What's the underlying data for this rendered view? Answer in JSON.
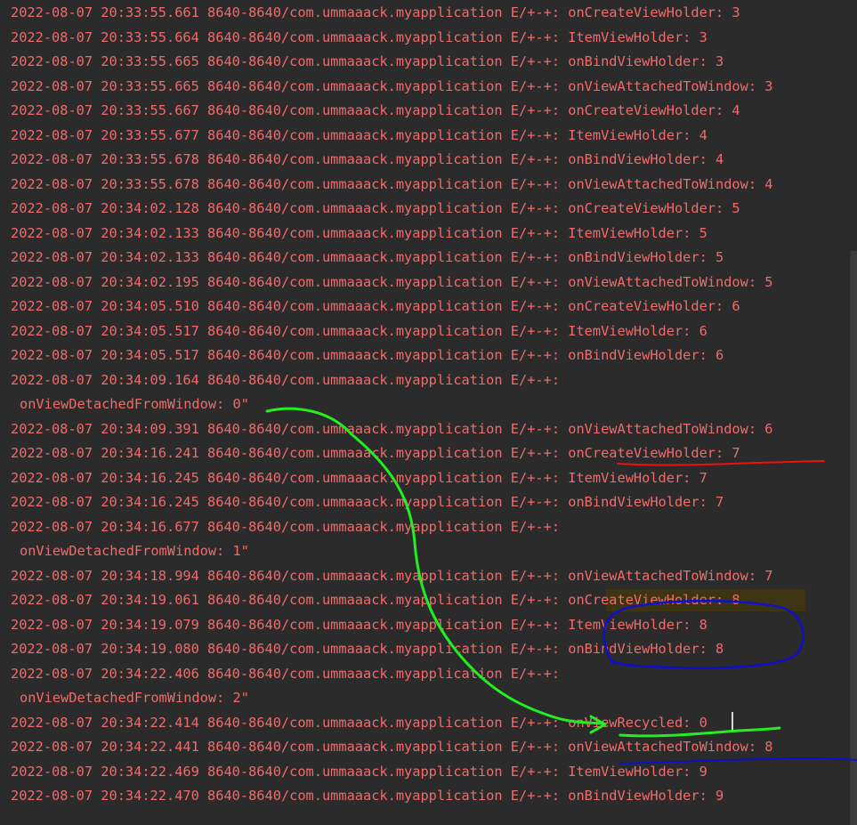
{
  "log": {
    "lines": [
      "2022-08-07 20:33:55.661 8640-8640/com.ummaaack.myapplication E/+-+: onCreateViewHolder: 3",
      "2022-08-07 20:33:55.664 8640-8640/com.ummaaack.myapplication E/+-+: ItemViewHolder: 3",
      "2022-08-07 20:33:55.665 8640-8640/com.ummaaack.myapplication E/+-+: onBindViewHolder: 3",
      "2022-08-07 20:33:55.665 8640-8640/com.ummaaack.myapplication E/+-+: onViewAttachedToWindow: 3",
      "2022-08-07 20:33:55.667 8640-8640/com.ummaaack.myapplication E/+-+: onCreateViewHolder: 4",
      "2022-08-07 20:33:55.677 8640-8640/com.ummaaack.myapplication E/+-+: ItemViewHolder: 4",
      "2022-08-07 20:33:55.678 8640-8640/com.ummaaack.myapplication E/+-+: onBindViewHolder: 4",
      "2022-08-07 20:33:55.678 8640-8640/com.ummaaack.myapplication E/+-+: onViewAttachedToWindow: 4",
      "2022-08-07 20:34:02.128 8640-8640/com.ummaaack.myapplication E/+-+: onCreateViewHolder: 5",
      "2022-08-07 20:34:02.133 8640-8640/com.ummaaack.myapplication E/+-+: ItemViewHolder: 5",
      "2022-08-07 20:34:02.133 8640-8640/com.ummaaack.myapplication E/+-+: onBindViewHolder: 5",
      "2022-08-07 20:34:02.195 8640-8640/com.ummaaack.myapplication E/+-+: onViewAttachedToWindow: 5",
      "2022-08-07 20:34:05.510 8640-8640/com.ummaaack.myapplication E/+-+: onCreateViewHolder: 6",
      "2022-08-07 20:34:05.517 8640-8640/com.ummaaack.myapplication E/+-+: ItemViewHolder: 6",
      "2022-08-07 20:34:05.517 8640-8640/com.ummaaack.myapplication E/+-+: onBindViewHolder: 6",
      "2022-08-07 20:34:09.164 8640-8640/com.ummaaack.myapplication E/+-+:",
      "onViewDetachedFromWindow: 0\"",
      "2022-08-07 20:34:09.391 8640-8640/com.ummaaack.myapplication E/+-+: onViewAttachedToWindow: 6",
      "2022-08-07 20:34:16.241 8640-8640/com.ummaaack.myapplication E/+-+: onCreateViewHolder: 7",
      "2022-08-07 20:34:16.245 8640-8640/com.ummaaack.myapplication E/+-+: ItemViewHolder: 7",
      "2022-08-07 20:34:16.245 8640-8640/com.ummaaack.myapplication E/+-+: onBindViewHolder: 7",
      "2022-08-07 20:34:16.677 8640-8640/com.ummaaack.myapplication E/+-+:",
      "onViewDetachedFromWindow: 1\"",
      "2022-08-07 20:34:18.994 8640-8640/com.ummaaack.myapplication E/+-+: onViewAttachedToWindow: 7",
      "2022-08-07 20:34:19.061 8640-8640/com.ummaaack.myapplication E/+-+: onCreateViewHolder: 8",
      "2022-08-07 20:34:19.079 8640-8640/com.ummaaack.myapplication E/+-+: ItemViewHolder: 8",
      "2022-08-07 20:34:19.080 8640-8640/com.ummaaack.myapplication E/+-+: onBindViewHolder: 8",
      "2022-08-07 20:34:22.406 8640-8640/com.ummaaack.myapplication E/+-+:",
      "onViewDetachedFromWindow: 2\"",
      "2022-08-07 20:34:22.414 8640-8640/com.ummaaack.myapplication E/+-+: onViewRecycled: 0",
      "2022-08-07 20:34:22.441 8640-8640/com.ummaaack.myapplication E/+-+: onViewAttachedToWindow: 8",
      "2022-08-07 20:34:22.469 8640-8640/com.ummaaack.myapplication E/+-+: ItemViewHolder: 9",
      "2022-08-07 20:34:22.470 8640-8640/com.ummaaack.myapplication E/+-+: onBindViewHolder: 9"
    ]
  },
  "colors": {
    "background": "#2b2b2b",
    "log_text": "#f26b6b",
    "search_highlight": "#3c3413",
    "annotation_green": "#22ee22",
    "annotation_blue": "#1010cc",
    "annotation_red": "#ee1111"
  }
}
